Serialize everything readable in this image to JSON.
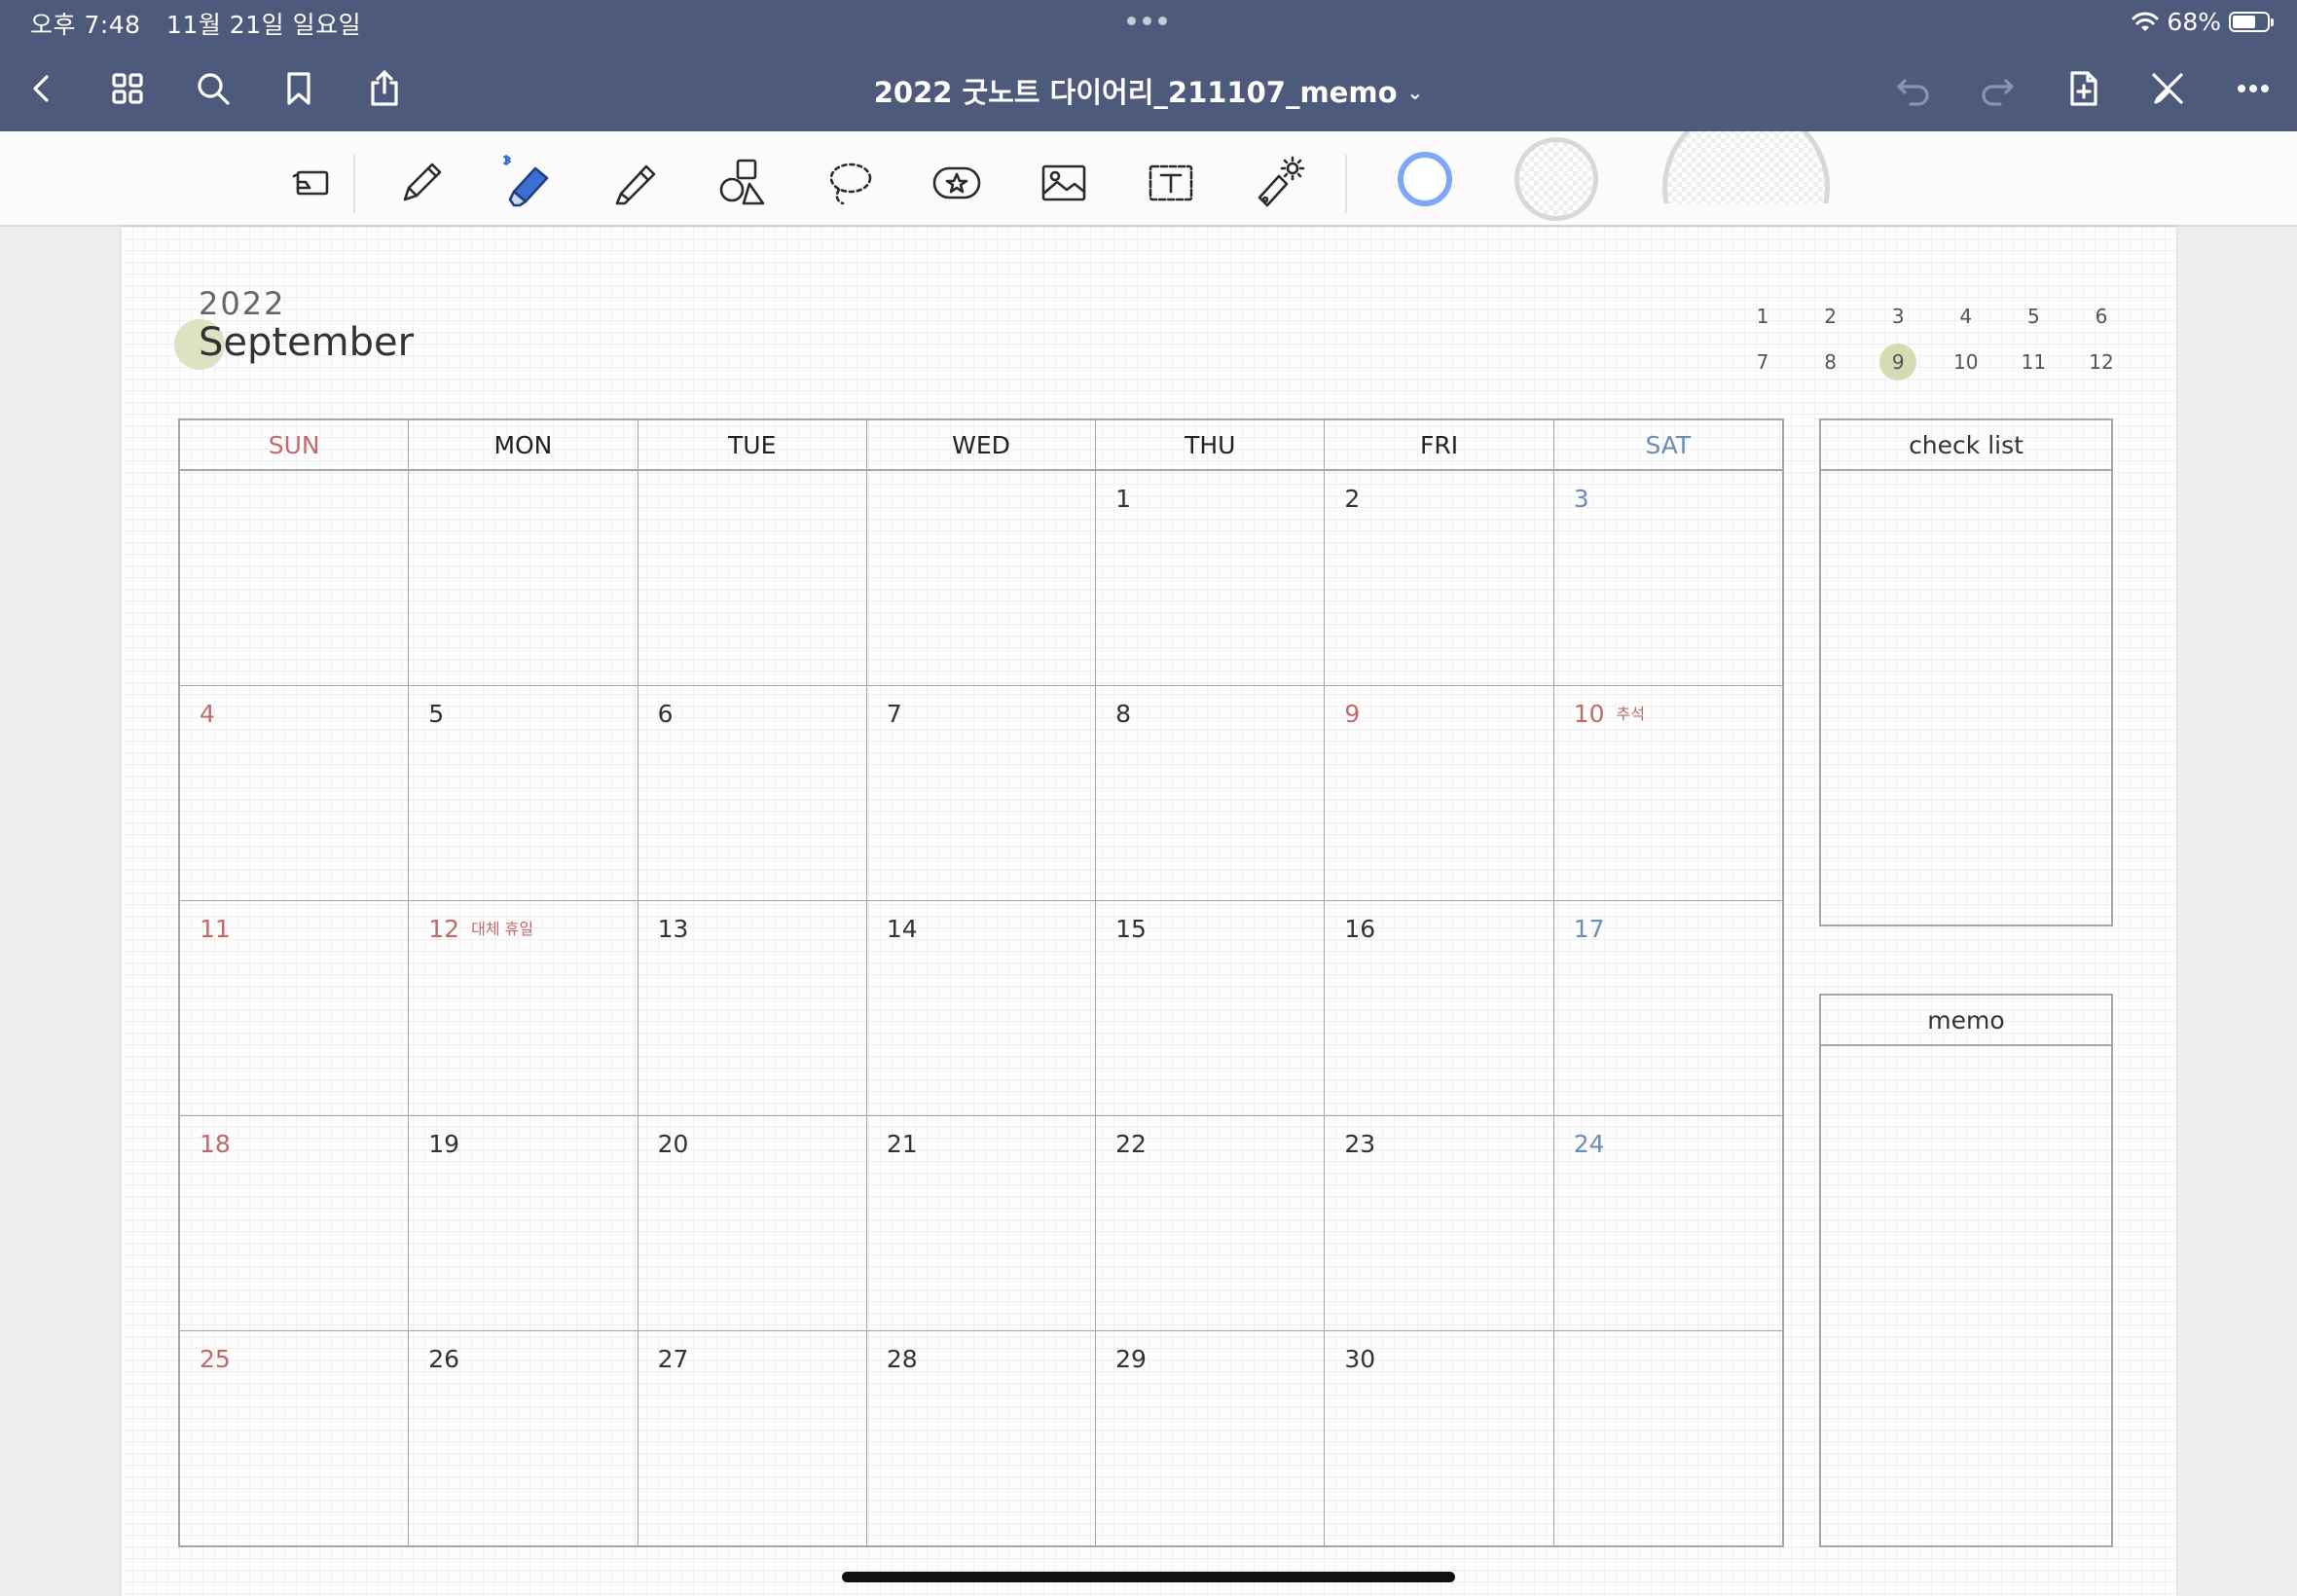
{
  "status": {
    "time": "오후 7:48",
    "date": "11월 21일 일요일",
    "battery": "68%",
    "battery_level": 0.68
  },
  "titlebar": {
    "title": "2022 굿노트 다이어리_211107_memo",
    "title_chevron": "⌄"
  },
  "nav_icons": [
    "back-icon",
    "thumbnails-icon",
    "search-icon",
    "bookmark-icon",
    "share-icon",
    "undo-icon",
    "redo-icon",
    "add-page-icon",
    "close-tools-icon",
    "more-icon"
  ],
  "tools": [
    "zoom-window-icon",
    "pen-icon",
    "eraser-icon",
    "highlighter-icon",
    "shapes-icon",
    "lasso-icon",
    "elements-icon",
    "image-icon",
    "text-icon",
    "laser-pointer-icon"
  ],
  "colors": {
    "nav_bg": "#4e5a7b",
    "accent": "#4a7fd8",
    "sun": "#c06b6b",
    "sat": "#6e8db4",
    "highlight": "#d7dbb4"
  },
  "calendar": {
    "year": "2022",
    "month": "September",
    "mini_months": [
      [
        "1",
        "2",
        "3",
        "4",
        "5",
        "6"
      ],
      [
        "7",
        "8",
        "9",
        "10",
        "11",
        "12"
      ]
    ],
    "current_month": "9",
    "weekdays": [
      "SUN",
      "MON",
      "TUE",
      "WED",
      "THU",
      "FRI",
      "SAT"
    ],
    "weeks": [
      [
        {
          "d": ""
        },
        {
          "d": ""
        },
        {
          "d": ""
        },
        {
          "d": ""
        },
        {
          "d": "1"
        },
        {
          "d": "2"
        },
        {
          "d": "3"
        }
      ],
      [
        {
          "d": "4"
        },
        {
          "d": "5"
        },
        {
          "d": "6"
        },
        {
          "d": "7"
        },
        {
          "d": "8"
        },
        {
          "d": "9",
          "red": true
        },
        {
          "d": "10",
          "red": true,
          "holiday": "추석"
        }
      ],
      [
        {
          "d": "11"
        },
        {
          "d": "12",
          "red": true,
          "holiday": "대체 휴일"
        },
        {
          "d": "13"
        },
        {
          "d": "14"
        },
        {
          "d": "15"
        },
        {
          "d": "16"
        },
        {
          "d": "17"
        }
      ],
      [
        {
          "d": "18"
        },
        {
          "d": "19"
        },
        {
          "d": "20"
        },
        {
          "d": "21"
        },
        {
          "d": "22"
        },
        {
          "d": "23"
        },
        {
          "d": "24"
        }
      ],
      [
        {
          "d": "25"
        },
        {
          "d": "26"
        },
        {
          "d": "27"
        },
        {
          "d": "28"
        },
        {
          "d": "29"
        },
        {
          "d": "30"
        },
        {
          "d": ""
        }
      ]
    ]
  },
  "panels": {
    "checklist_title": "check list",
    "memo_title": "memo"
  }
}
